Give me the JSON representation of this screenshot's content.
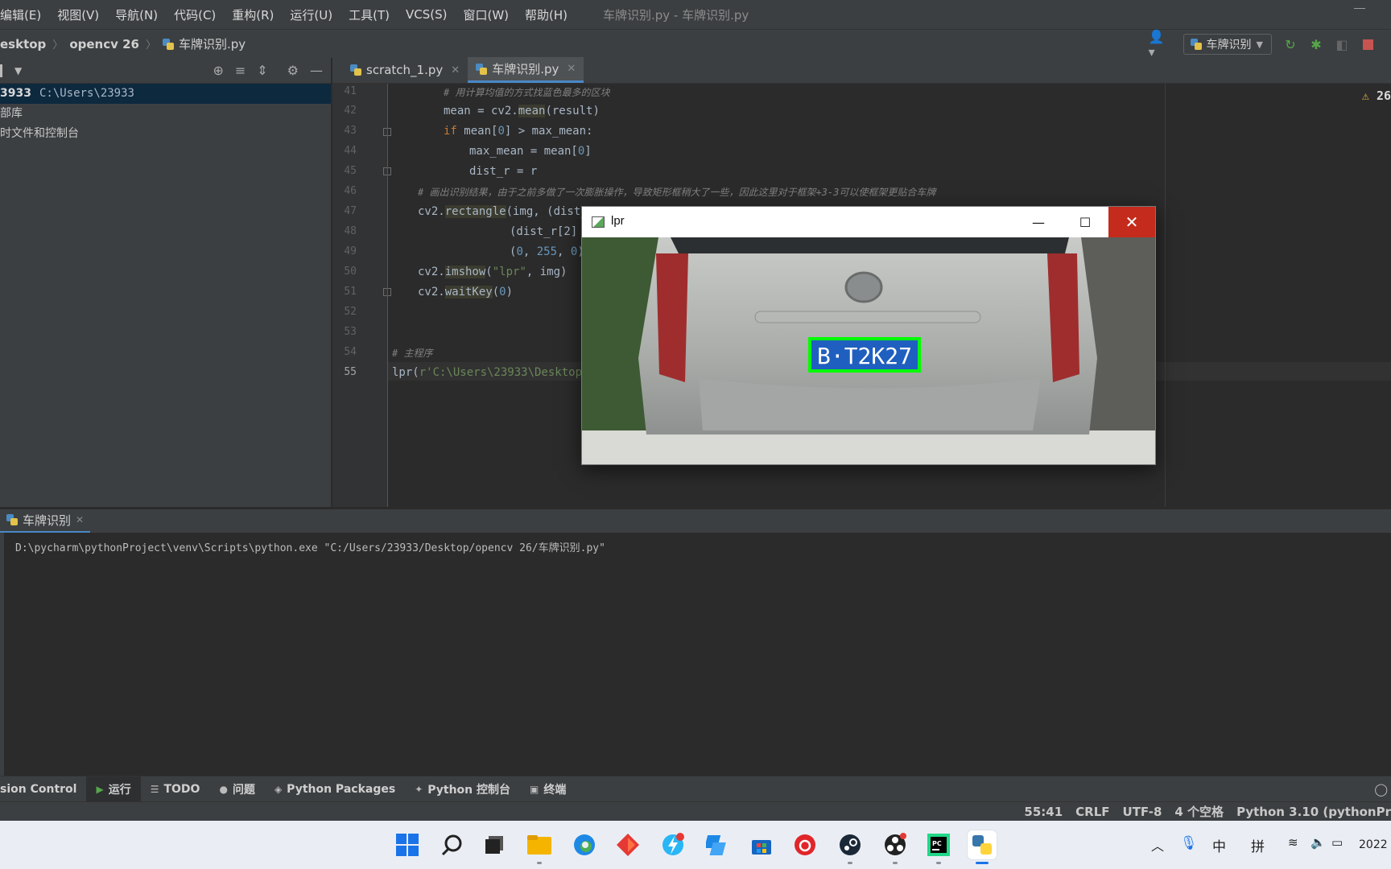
{
  "menu": {
    "items": [
      "编辑(E)",
      "视图(V)",
      "导航(N)",
      "代码(C)",
      "重构(R)",
      "运行(U)",
      "工具(T)",
      "VCS(S)",
      "窗口(W)",
      "帮助(H)"
    ],
    "window_title": "车牌识别.py - 车牌识别.py"
  },
  "nav": {
    "crumbs": [
      "esktop",
      "opencv 26",
      "车牌识别.py"
    ],
    "run_config": "车牌识别"
  },
  "project": {
    "rows": [
      {
        "bold": "3933",
        "path": "C:\\Users\\23933"
      },
      {
        "bold": "",
        "path": "",
        "label": "部库"
      },
      {
        "bold": "",
        "path": "",
        "label": "时文件和控制台"
      }
    ]
  },
  "tabs": [
    {
      "label": "scratch_1.py",
      "active": false
    },
    {
      "label": "车牌识别.py",
      "active": true
    }
  ],
  "editor": {
    "warnings": "26",
    "line_numbers": [
      "41",
      "42",
      "43",
      "44",
      "45",
      "46",
      "47",
      "48",
      "49",
      "50",
      "51",
      "52",
      "53",
      "54",
      "55"
    ],
    "lines": {
      "l41": "# 用计算均值的方式找蓝色最多的区块",
      "l42a": "mean = cv2.",
      "l42b": "mean",
      "l42c": "(result)",
      "l43a": "if ",
      "l43b": "mean[",
      "l43c": "0",
      "l43d": "] > max_mean:",
      "l44a": "max_mean = mean[",
      "l44b": "0",
      "l44c": "]",
      "l45": "dist_r = r",
      "l46": "# 画出识别结果，由于之前多做了一次膨胀操作，导致矩形框稍大了一些，因此这里对于框架+3-3可以使框架更贴合车牌",
      "l47a": "cv2.",
      "l47b": "rectangle",
      "l47c": "(img, (dist_r",
      "l48": "(dist_r[2] +",
      "l49a": "(",
      "l49b": "0",
      "l49c": ", ",
      "l49d": "255",
      "l49e": ", ",
      "l49f": "0",
      "l49g": "),",
      "l50a": "cv2.",
      "l50b": "imshow",
      "l50c": "(",
      "l50d": "\"lpr\"",
      "l50e": ", img)",
      "l51a": "cv2.",
      "l51b": "waitKey",
      "l51c": "(",
      "l51d": "0",
      "l51e": ")",
      "l54": "# 主程序",
      "l55a": "lpr(",
      "l55b": "r'C:\\Users\\23933\\Desktop\\o"
    }
  },
  "lpr_window": {
    "title": "lpr",
    "plate_text": "B·T2K27"
  },
  "run": {
    "tab_label": "车牌识别",
    "command": "D:\\pycharm\\pythonProject\\venv\\Scripts\\python.exe \"C:/Users/23933/Desktop/opencv 26/车牌识别.py\""
  },
  "tool_windows": {
    "version_control": "sion Control",
    "run": "运行",
    "todo": "TODO",
    "problems": "问题",
    "python_packages": "Python Packages",
    "python_console": "Python 控制台",
    "terminal": "终端"
  },
  "status": {
    "position": "55:41",
    "line_sep": "CRLF",
    "encoding": "UTF-8",
    "indent": "4 个空格",
    "interpreter": "Python 3.10 (pythonPr"
  },
  "tray": {
    "ime_lang": "中",
    "ime_mode": "拼",
    "clock": "2022"
  },
  "colors": {
    "accent": "#4a88c7",
    "close_red": "#c42b1c",
    "plate_blue": "#1f5fbf",
    "frame_green": "#00ff00"
  }
}
